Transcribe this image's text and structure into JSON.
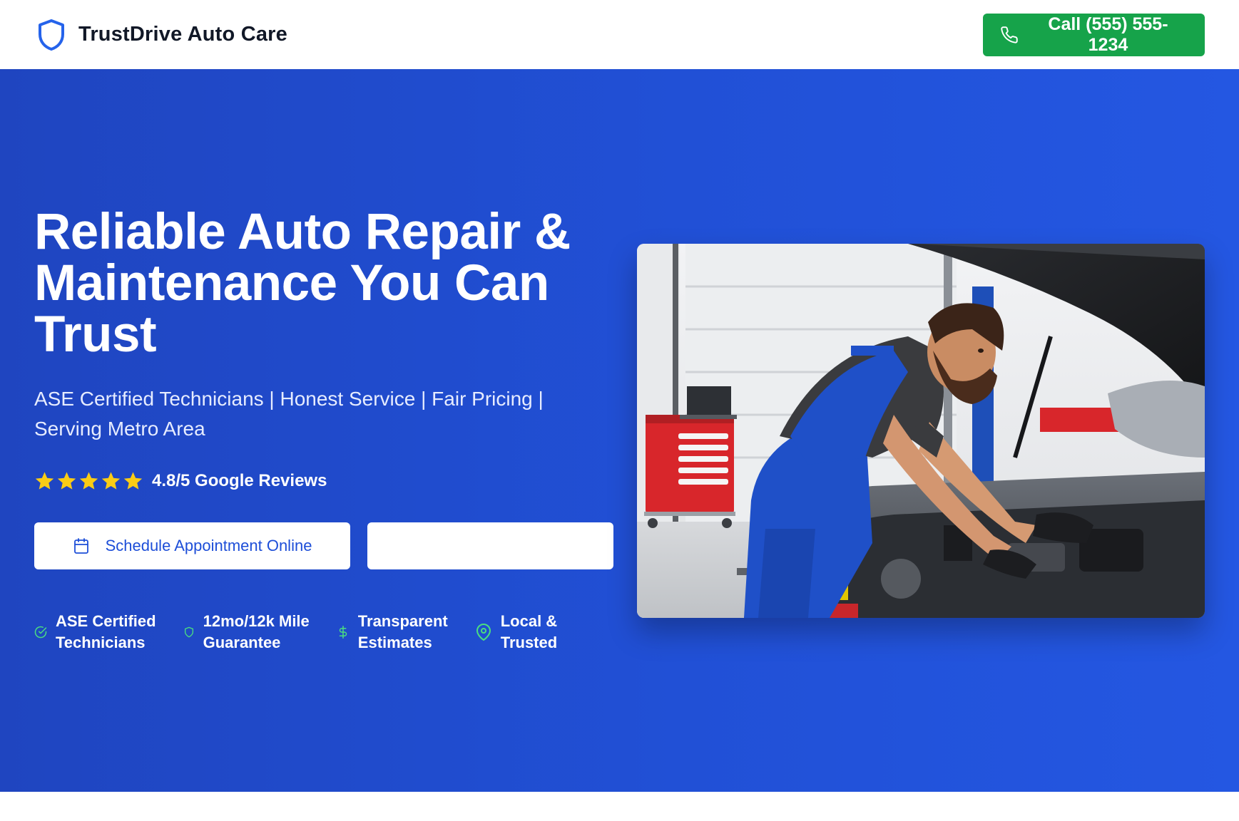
{
  "header": {
    "brand_name": "TrustDrive Auto Care",
    "brand_icon": "shield-icon",
    "call_label": "Call (555) 555-1234",
    "call_icon": "phone-icon"
  },
  "hero": {
    "title_line1": "Reliable Auto Repair &",
    "title_line2": "Maintenance You Can",
    "title_line3": "Trust",
    "subtitle_line1": "ASE Certified Technicians | Honest Service | Fair Pricing |",
    "subtitle_line2": "Serving Metro Area",
    "rating": {
      "stars": 5,
      "text": "4.8/5 Google Reviews"
    },
    "cta_primary": {
      "label": "Schedule Appointment Online",
      "icon": "calendar-icon"
    },
    "cta_secondary": {
      "label": ""
    },
    "badges": [
      {
        "icon": "check-circle-icon",
        "line1": "ASE Certified",
        "line2": "Technicians"
      },
      {
        "icon": "shield-icon",
        "line1": "12mo/12k Mile",
        "line2": "Guarantee"
      },
      {
        "icon": "dollar-icon",
        "line1": "Transparent",
        "line2": "Estimates"
      },
      {
        "icon": "map-pin-icon",
        "line1": "Local &",
        "line2": "Trusted"
      }
    ],
    "image": {
      "subject": "mechanic-working-under-car-hood"
    }
  },
  "colors": {
    "brand_blue": "#2150d6",
    "call_green": "#16a34a",
    "star_yellow": "#facc15",
    "badge_green": "#4ade80",
    "link_blue": "#1d4ed8"
  }
}
